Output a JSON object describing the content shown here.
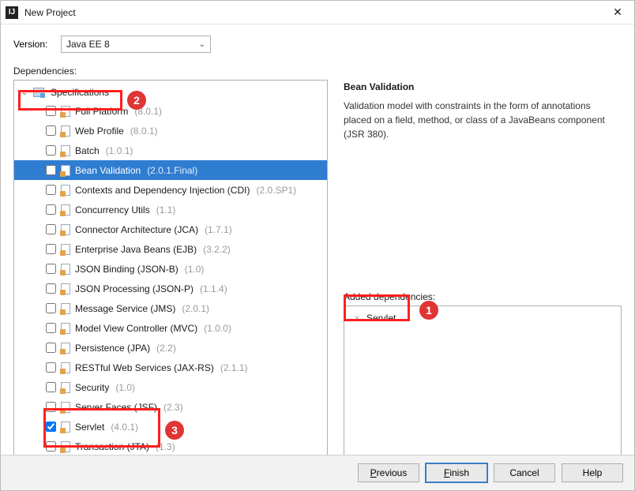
{
  "window": {
    "title": "New Project",
    "close_glyph": "✕"
  },
  "version": {
    "label": "Version:",
    "value": "Java EE 8",
    "chevron": "⌄"
  },
  "dependencies_label": "Dependencies:",
  "tree": {
    "root_label": "Specifications",
    "root_arrow": "⌄",
    "items": [
      {
        "name": "Full Platform",
        "ver": "(8.0.1)",
        "checked": false,
        "selected": false
      },
      {
        "name": "Web Profile",
        "ver": "(8.0.1)",
        "checked": false,
        "selected": false
      },
      {
        "name": "Batch",
        "ver": "(1.0.1)",
        "checked": false,
        "selected": false
      },
      {
        "name": "Bean Validation",
        "ver": "(2.0.1.Final)",
        "checked": false,
        "selected": true
      },
      {
        "name": "Contexts and Dependency Injection (CDI)",
        "ver": "(2.0.SP1)",
        "checked": false,
        "selected": false
      },
      {
        "name": "Concurrency Utils",
        "ver": "(1.1)",
        "checked": false,
        "selected": false
      },
      {
        "name": "Connector Architecture (JCA)",
        "ver": "(1.7.1)",
        "checked": false,
        "selected": false
      },
      {
        "name": "Enterprise Java Beans (EJB)",
        "ver": "(3.2.2)",
        "checked": false,
        "selected": false
      },
      {
        "name": "JSON Binding (JSON-B)",
        "ver": "(1.0)",
        "checked": false,
        "selected": false
      },
      {
        "name": "JSON Processing (JSON-P)",
        "ver": "(1.1.4)",
        "checked": false,
        "selected": false
      },
      {
        "name": "Message Service (JMS)",
        "ver": "(2.0.1)",
        "checked": false,
        "selected": false
      },
      {
        "name": "Model View Controller (MVC)",
        "ver": "(1.0.0)",
        "checked": false,
        "selected": false
      },
      {
        "name": "Persistence (JPA)",
        "ver": "(2.2)",
        "checked": false,
        "selected": false
      },
      {
        "name": "RESTful Web Services (JAX-RS)",
        "ver": "(2.1.1)",
        "checked": false,
        "selected": false
      },
      {
        "name": "Security",
        "ver": "(1.0)",
        "checked": false,
        "selected": false
      },
      {
        "name": "Server Faces (JSF)",
        "ver": "(2.3)",
        "checked": false,
        "selected": false
      },
      {
        "name": "Servlet",
        "ver": "(4.0.1)",
        "checked": true,
        "selected": false
      },
      {
        "name": "Transaction (JTA)",
        "ver": "(1.3)",
        "checked": false,
        "selected": false
      }
    ]
  },
  "details": {
    "title": "Bean Validation",
    "text": "Validation model with constraints in the form of annotations placed on a field, method, or class of a JavaBeans component (JSR 380)."
  },
  "added": {
    "label": "Added dependencies:",
    "items": [
      {
        "name": "Servlet"
      }
    ]
  },
  "footer": {
    "previous": "Previous",
    "finish": "Finish",
    "cancel": "Cancel",
    "help": "Help"
  },
  "callouts": {
    "c1": "1",
    "c2": "2",
    "c3": "3"
  }
}
